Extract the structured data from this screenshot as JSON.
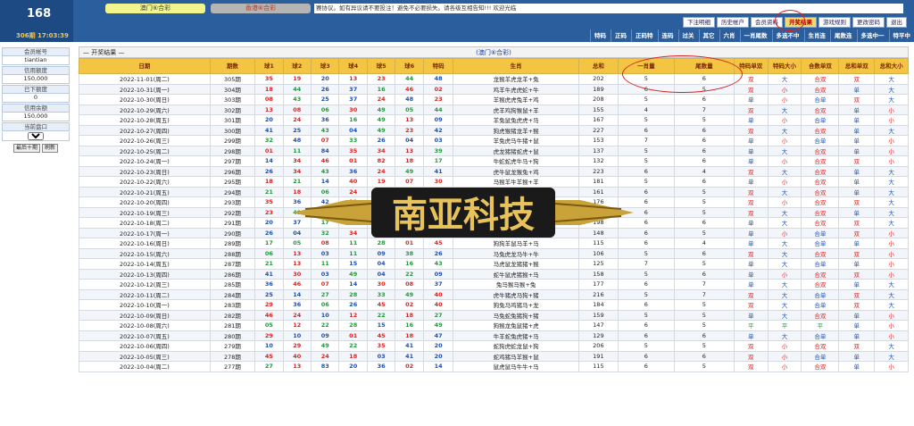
{
  "logo": {
    "num": "168",
    "time": "306期 17:03:39"
  },
  "game_tabs": [
    "澳门⑥合彩",
    "香港⑥合彩"
  ],
  "notice": "赛协议。如有异议请不要投注！避免不必要损失。请各级互相告知!!! 欢迎光临",
  "menu1": [
    "下注明细",
    "历史帐户",
    "会员资料",
    "开奖结果",
    "游戏规则",
    "更改密码",
    "退出"
  ],
  "menu1_active": "开奖结果",
  "menu2": [
    "特码",
    "正码",
    "正码特",
    "连码",
    "过关",
    "其它",
    "六肖",
    "一肖尾数",
    "多选不中",
    "生肖连",
    "尾数连",
    "多选中一",
    "特平中"
  ],
  "sidebar": {
    "account_label": "会员帐号",
    "account": "tiantian",
    "credit_label": "信用额度",
    "credit": "150,000",
    "used_label": "已下额度",
    "used": "0",
    "balance_label": "信用余额",
    "balance": "150,000",
    "pan_label": "当前盘口",
    "pan": "C盘",
    "recent10": "最后十期",
    "refresh": "刷新"
  },
  "section_title": "— 开奖结果 —",
  "game_name": "(澳门⑥合彩)",
  "headers": [
    "日期",
    "期数",
    "球1",
    "球2",
    "球3",
    "球4",
    "球5",
    "球6",
    "特码",
    "生肖",
    "总和",
    "一肖量",
    "尾数量",
    "特码单双",
    "特码大小",
    "合数单双",
    "总和单双",
    "总和大小"
  ],
  "watermark": "南亚科技",
  "rows": [
    [
      "2022-11-01(周二)",
      "305期",
      [
        "35",
        "red"
      ],
      [
        "19",
        "red"
      ],
      [
        "20",
        "blue"
      ],
      [
        "13",
        "red"
      ],
      [
        "23",
        "red"
      ],
      [
        "44",
        "green"
      ],
      [
        "48",
        "blue"
      ],
      "龙猴羊虎龙羊+兔",
      "202",
      "5",
      "6",
      "双",
      "大",
      "合双",
      "双",
      "大"
    ],
    [
      "2022-10-31(周一)",
      "304期",
      [
        "18",
        "red"
      ],
      [
        "44",
        "green"
      ],
      [
        "26",
        "blue"
      ],
      [
        "37",
        "blue"
      ],
      [
        "16",
        "green"
      ],
      [
        "46",
        "red"
      ],
      [
        "02",
        "red"
      ],
      "鸡羊牛虎虎蛇+牛",
      "189",
      "6",
      "5",
      "双",
      "小",
      "合双",
      "单",
      "大"
    ],
    [
      "2022-10-30(周日)",
      "303期",
      [
        "08",
        "red"
      ],
      [
        "43",
        "green"
      ],
      [
        "25",
        "blue"
      ],
      [
        "37",
        "blue"
      ],
      [
        "24",
        "red"
      ],
      [
        "48",
        "blue"
      ],
      [
        "23",
        "red"
      ],
      "羊猴虎虎兔羊+鸡",
      "208",
      "5",
      "6",
      "单",
      "小",
      "合单",
      "双",
      "大"
    ],
    [
      "2022-10-29(周六)",
      "302期",
      [
        "13",
        "red"
      ],
      [
        "08",
        "red"
      ],
      [
        "06",
        "green"
      ],
      [
        "30",
        "red"
      ],
      [
        "49",
        "green"
      ],
      [
        "05",
        "green"
      ],
      [
        "44",
        "green"
      ],
      "虎羊鸡狗猴鼠+羊",
      "155",
      "4",
      "7",
      "双",
      "大",
      "合双",
      "单",
      "小"
    ],
    [
      "2022-10-28(周五)",
      "301期",
      [
        "20",
        "blue"
      ],
      [
        "24",
        "red"
      ],
      [
        "36",
        "blue"
      ],
      [
        "16",
        "green"
      ],
      [
        "49",
        "green"
      ],
      [
        "13",
        "red"
      ],
      [
        "09",
        "blue"
      ],
      "羊兔鼠兔虎虎+马",
      "167",
      "5",
      "5",
      "单",
      "小",
      "合单",
      "单",
      "小"
    ],
    [
      "2022-10-27(周四)",
      "300期",
      [
        "41",
        "blue"
      ],
      [
        "25",
        "blue"
      ],
      [
        "43",
        "green"
      ],
      [
        "04",
        "blue"
      ],
      [
        "49",
        "green"
      ],
      [
        "23",
        "red"
      ],
      [
        "42",
        "blue"
      ],
      "狗虎猴猪龙羊+猴",
      "227",
      "6",
      "6",
      "双",
      "大",
      "合双",
      "单",
      "大"
    ],
    [
      "2022-10-26(周三)",
      "299期",
      [
        "32",
        "green"
      ],
      [
        "48",
        "blue"
      ],
      [
        "07",
        "red"
      ],
      [
        "33",
        "green"
      ],
      [
        "26",
        "blue"
      ],
      [
        "04",
        "blue"
      ],
      [
        "03",
        "blue"
      ],
      "羊兔虎马牛猪+鼠",
      "153",
      "7",
      "6",
      "单",
      "小",
      "合单",
      "单",
      "小"
    ],
    [
      "2022-10-25(周二)",
      "298期",
      [
        "01",
        "red"
      ],
      [
        "11",
        "green"
      ],
      [
        "84",
        "blue"
      ],
      [
        "35",
        "red"
      ],
      [
        "34",
        "red"
      ],
      [
        "13",
        "red"
      ],
      [
        "39",
        "green"
      ],
      "虎龙猪猪蛇虎+鼠",
      "137",
      "5",
      "6",
      "单",
      "大",
      "合双",
      "单",
      "小"
    ],
    [
      "2022-10-24(周一)",
      "297期",
      [
        "14",
        "blue"
      ],
      [
        "34",
        "red"
      ],
      [
        "46",
        "red"
      ],
      [
        "01",
        "red"
      ],
      [
        "82",
        "red"
      ],
      [
        "18",
        "red"
      ],
      [
        "17",
        "green"
      ],
      "牛蛇蛇虎牛马+狗",
      "132",
      "5",
      "6",
      "单",
      "小",
      "合双",
      "双",
      "小"
    ],
    [
      "2022-10-23(周日)",
      "296期",
      [
        "26",
        "blue"
      ],
      [
        "34",
        "red"
      ],
      [
        "43",
        "green"
      ],
      [
        "36",
        "blue"
      ],
      [
        "24",
        "red"
      ],
      [
        "49",
        "green"
      ],
      [
        "41",
        "blue"
      ],
      "虎牛鼠龙猴兔+鸡",
      "223",
      "6",
      "4",
      "双",
      "大",
      "合双",
      "单",
      "大"
    ],
    [
      "2022-10-22(周六)",
      "295期",
      [
        "18",
        "red"
      ],
      [
        "21",
        "green"
      ],
      [
        "14",
        "blue"
      ],
      [
        "40",
        "red"
      ],
      [
        "19",
        "red"
      ],
      [
        "07",
        "red"
      ],
      [
        "30",
        "red"
      ],
      "马猴羊牛羊猴+羊",
      "181",
      "5",
      "6",
      "单",
      "小",
      "合双",
      "单",
      "大"
    ],
    [
      "2022-10-21(周五)",
      "294期",
      [
        "21",
        "green"
      ],
      [
        "18",
        "red"
      ],
      [
        "06",
        "green"
      ],
      [
        "24",
        "red"
      ],
      [
        "38",
        "green"
      ],
      [
        "17",
        "green"
      ],
      [
        "36",
        "blue"
      ],
      "鼠猴马鸡猴龙+狗",
      "161",
      "6",
      "5",
      "双",
      "大",
      "合双",
      "单",
      "大"
    ],
    [
      "2022-10-20(周四)",
      "293期",
      [
        "35",
        "red"
      ],
      [
        "36",
        "blue"
      ],
      [
        "42",
        "blue"
      ],
      [
        "11",
        "green"
      ],
      [
        "05",
        "green"
      ],
      [
        "41",
        "blue"
      ],
      [
        "04",
        "blue"
      ],
      "龙虎狗鼠马牛+兔",
      "176",
      "6",
      "5",
      "双",
      "小",
      "合双",
      "双",
      "大"
    ],
    [
      "2022-10-19(周三)",
      "292期",
      [
        "23",
        "red"
      ],
      [
        "49",
        "green"
      ],
      [
        "28",
        "green"
      ],
      [
        "03",
        "blue"
      ],
      [
        "46",
        "red"
      ],
      [
        "42",
        "blue"
      ],
      [
        "46",
        "red"
      ],
      "龙虎鼠鼠马猴+蛇",
      "237",
      "6",
      "5",
      "双",
      "大",
      "合双",
      "单",
      "大"
    ],
    [
      "2022-10-18(周二)",
      "291期",
      [
        "20",
        "blue"
      ],
      [
        "37",
        "blue"
      ],
      [
        "17",
        "green"
      ],
      [
        "33",
        "green"
      ],
      [
        "44",
        "green"
      ],
      [
        "12",
        "red"
      ],
      [
        "35",
        "red"
      ],
      "鸡猴猪牛虎龙+龙",
      "198",
      "6",
      "6",
      "单",
      "大",
      "合双",
      "双",
      "大"
    ],
    [
      "2022-10-17(周一)",
      "290期",
      [
        "26",
        "blue"
      ],
      [
        "04",
        "blue"
      ],
      [
        "32",
        "green"
      ],
      [
        "34",
        "red"
      ],
      [
        "11",
        "green"
      ],
      [
        "22",
        "green"
      ],
      [
        "19",
        "red"
      ],
      "牛猪羊蛇龙蛇+猴",
      "148",
      "6",
      "5",
      "单",
      "小",
      "合单",
      "双",
      "小"
    ],
    [
      "2022-10-16(周日)",
      "289期",
      [
        "17",
        "green"
      ],
      [
        "05",
        "green"
      ],
      [
        "08",
        "red"
      ],
      [
        "11",
        "green"
      ],
      [
        "28",
        "green"
      ],
      [
        "01",
        "red"
      ],
      [
        "45",
        "red"
      ],
      "狗狗羊鼠马羊+马",
      "115",
      "6",
      "4",
      "单",
      "大",
      "合单",
      "单",
      "小"
    ],
    [
      "2022-10-15(周六)",
      "288期",
      [
        "06",
        "green"
      ],
      [
        "13",
        "red"
      ],
      [
        "03",
        "blue"
      ],
      [
        "11",
        "green"
      ],
      [
        "09",
        "blue"
      ],
      [
        "38",
        "green"
      ],
      [
        "26",
        "blue"
      ],
      "马兔虎龙马牛+牛",
      "106",
      "5",
      "6",
      "双",
      "大",
      "合双",
      "双",
      "小"
    ],
    [
      "2022-10-14(周五)",
      "287期",
      [
        "21",
        "green"
      ],
      [
        "13",
        "red"
      ],
      [
        "11",
        "green"
      ],
      [
        "15",
        "blue"
      ],
      [
        "04",
        "blue"
      ],
      [
        "16",
        "green"
      ],
      [
        "43",
        "green"
      ],
      "马虎鼠龙猪猪+猴",
      "125",
      "7",
      "5",
      "单",
      "大",
      "合单",
      "单",
      "小"
    ],
    [
      "2022-10-13(周四)",
      "286期",
      [
        "41",
        "blue"
      ],
      [
        "30",
        "red"
      ],
      [
        "03",
        "blue"
      ],
      [
        "49",
        "green"
      ],
      [
        "04",
        "blue"
      ],
      [
        "22",
        "green"
      ],
      [
        "09",
        "blue"
      ],
      "蛇牛鼠虎猪猴+马",
      "158",
      "5",
      "6",
      "单",
      "小",
      "合双",
      "双",
      "小"
    ],
    [
      "2022-10-12(周三)",
      "285期",
      [
        "36",
        "blue"
      ],
      [
        "46",
        "red"
      ],
      [
        "07",
        "red"
      ],
      [
        "14",
        "blue"
      ],
      [
        "30",
        "red"
      ],
      [
        "08",
        "red"
      ],
      [
        "37",
        "blue"
      ],
      "兔马猴马猴+兔",
      "177",
      "6",
      "7",
      "单",
      "大",
      "合双",
      "单",
      "大"
    ],
    [
      "2022-10-11(周二)",
      "284期",
      [
        "25",
        "blue"
      ],
      [
        "14",
        "blue"
      ],
      [
        "27",
        "green"
      ],
      [
        "28",
        "green"
      ],
      [
        "33",
        "green"
      ],
      [
        "49",
        "green"
      ],
      [
        "40",
        "red"
      ],
      "虎牛猪虎马狗+猪",
      "216",
      "5",
      "7",
      "双",
      "大",
      "合单",
      "双",
      "大"
    ],
    [
      "2022-10-10(周一)",
      "283期",
      [
        "29",
        "red"
      ],
      [
        "36",
        "blue"
      ],
      [
        "06",
        "green"
      ],
      [
        "26",
        "blue"
      ],
      [
        "45",
        "red"
      ],
      [
        "02",
        "red"
      ],
      [
        "40",
        "red"
      ],
      "狗兔马鸡猪马+龙",
      "184",
      "6",
      "5",
      "双",
      "大",
      "合单",
      "双",
      "大"
    ],
    [
      "2022-10-09(周日)",
      "282期",
      [
        "46",
        "red"
      ],
      [
        "24",
        "red"
      ],
      [
        "10",
        "blue"
      ],
      [
        "12",
        "red"
      ],
      [
        "22",
        "green"
      ],
      [
        "18",
        "red"
      ],
      [
        "27",
        "green"
      ],
      "马兔蛇兔猪狗+猪",
      "159",
      "5",
      "5",
      "单",
      "大",
      "合双",
      "单",
      "小"
    ],
    [
      "2022-10-08(周六)",
      "281期",
      [
        "05",
        "green"
      ],
      [
        "12",
        "red"
      ],
      [
        "22",
        "green"
      ],
      [
        "28",
        "green"
      ],
      [
        "15",
        "blue"
      ],
      [
        "16",
        "green"
      ],
      [
        "49",
        "green"
      ],
      "狗猴龙兔鼠猪+虎",
      "147",
      "6",
      "5",
      "平",
      "平",
      "平",
      "单",
      "小"
    ],
    [
      "2022-10-07(周五)",
      "280期",
      [
        "29",
        "red"
      ],
      [
        "10",
        "blue"
      ],
      [
        "09",
        "blue"
      ],
      [
        "01",
        "red"
      ],
      [
        "45",
        "red"
      ],
      [
        "18",
        "red"
      ],
      [
        "47",
        "blue"
      ],
      "牛羊蛇兔虎猪+马",
      "129",
      "6",
      "6",
      "单",
      "大",
      "合单",
      "单",
      "小"
    ],
    [
      "2022-10-06(周四)",
      "279期",
      [
        "10",
        "blue"
      ],
      [
        "29",
        "red"
      ],
      [
        "49",
        "green"
      ],
      [
        "22",
        "green"
      ],
      [
        "35",
        "red"
      ],
      [
        "41",
        "blue"
      ],
      [
        "20",
        "blue"
      ],
      "蛇狗虎蛇龙鼠+狗",
      "206",
      "5",
      "5",
      "双",
      "小",
      "合双",
      "双",
      "大"
    ],
    [
      "2022-10-05(周三)",
      "278期",
      [
        "45",
        "red"
      ],
      [
        "40",
        "red"
      ],
      [
        "24",
        "red"
      ],
      [
        "18",
        "red"
      ],
      [
        "03",
        "blue"
      ],
      [
        "41",
        "blue"
      ],
      [
        "20",
        "blue"
      ],
      "蛇鸡猪马羊猴+鼠",
      "191",
      "6",
      "6",
      "双",
      "小",
      "合单",
      "单",
      "大"
    ],
    [
      "2022-10-04(周二)",
      "277期",
      [
        "27",
        "green"
      ],
      [
        "13",
        "red"
      ],
      [
        "83",
        "blue"
      ],
      [
        "20",
        "blue"
      ],
      [
        "36",
        "blue"
      ],
      [
        "02",
        "red"
      ],
      [
        "14",
        "blue"
      ],
      "鼠虎鼠马牛牛+马",
      "115",
      "6",
      "5",
      "双",
      "小",
      "合双",
      "单",
      "小"
    ]
  ]
}
